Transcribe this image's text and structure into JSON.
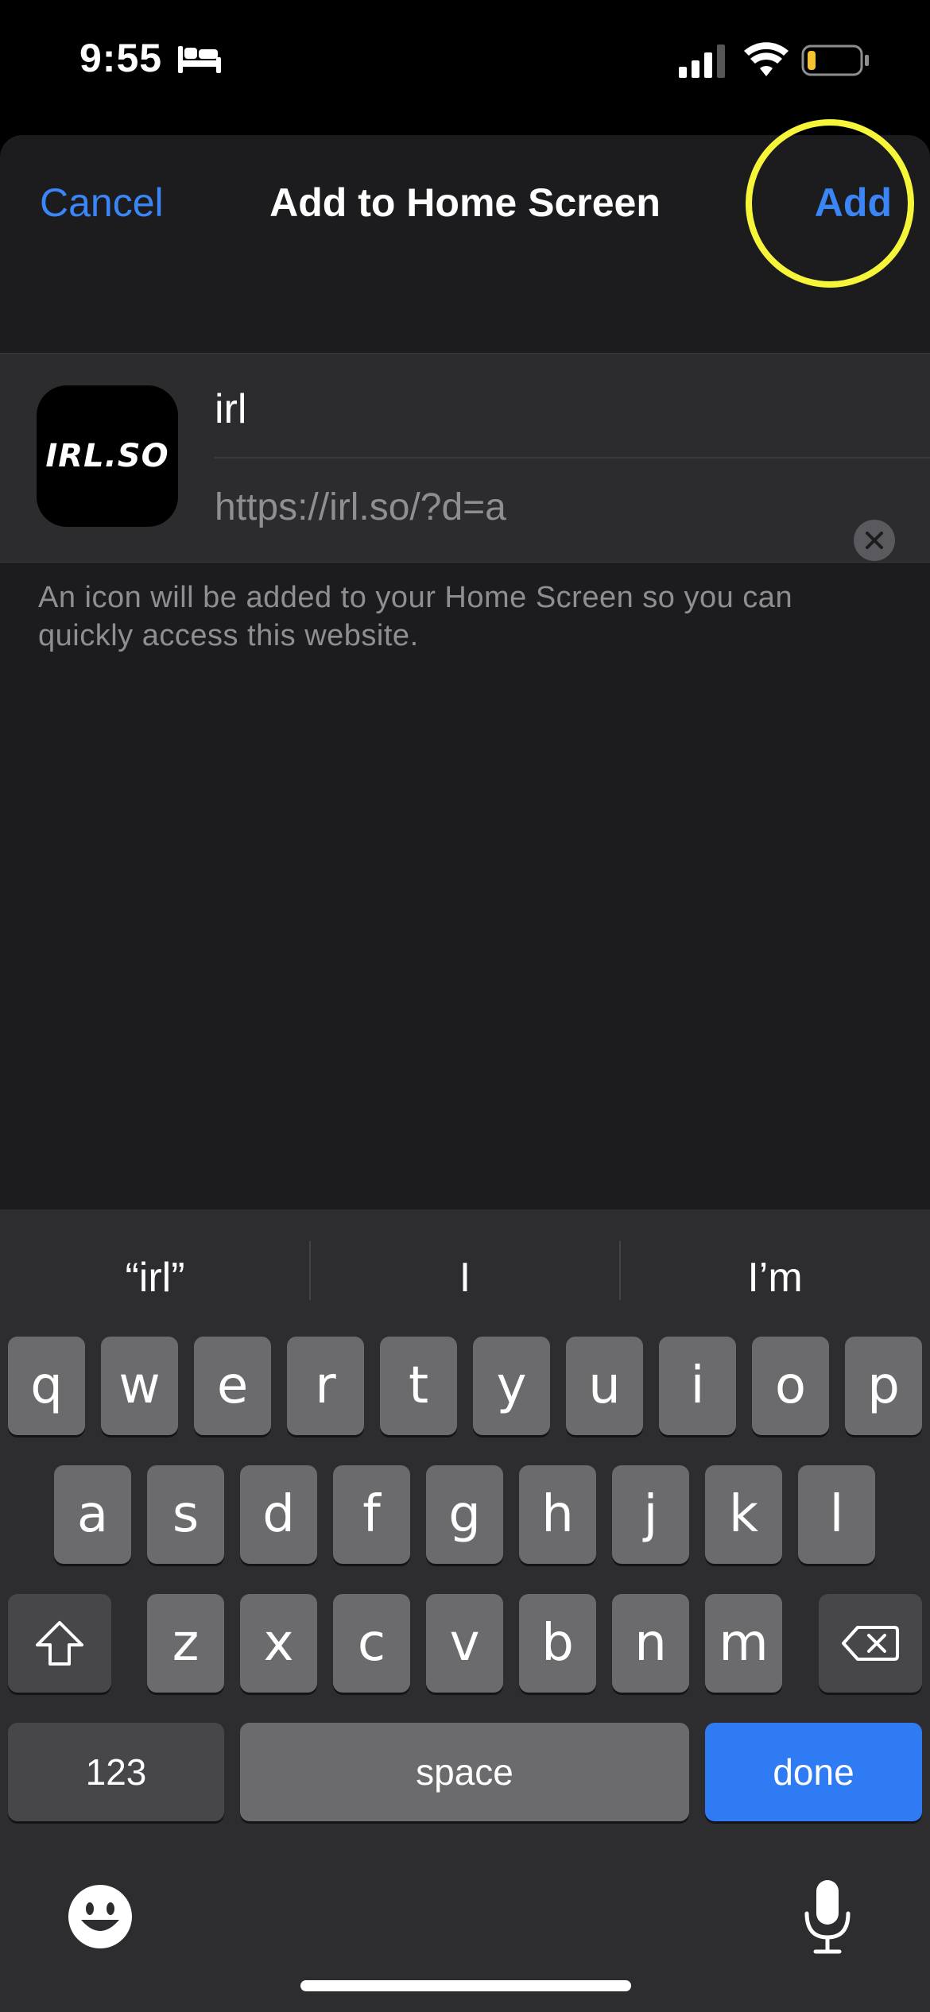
{
  "status_bar": {
    "time": "9:55",
    "focus_icon": "bed-icon",
    "signal_icon": "cellular-signal-icon",
    "wifi_icon": "wifi-icon",
    "battery_icon": "battery-low-icon",
    "battery_color": "#f4c430"
  },
  "nav": {
    "cancel_label": "Cancel",
    "title": "Add to Home Screen",
    "add_label": "Add",
    "highlight_color": "#f6f53a"
  },
  "entry": {
    "icon_text": "IRL.SO",
    "name_value": "irl",
    "url": "https://irl.so/?d=a",
    "clear_icon": "clear-text-icon"
  },
  "caption": "An icon will be added to your Home Screen so you can quickly access this website.",
  "keyboard": {
    "suggestions": [
      "“irl”",
      "I",
      "I’m"
    ],
    "row1": [
      "q",
      "w",
      "e",
      "r",
      "t",
      "y",
      "u",
      "i",
      "o",
      "p"
    ],
    "row2": [
      "a",
      "s",
      "d",
      "f",
      "g",
      "h",
      "j",
      "k",
      "l"
    ],
    "row3": [
      "z",
      "x",
      "c",
      "v",
      "b",
      "n",
      "m"
    ],
    "numbers_label": "123",
    "space_label": "space",
    "done_label": "done",
    "accent_color": "#2f7bf4"
  }
}
